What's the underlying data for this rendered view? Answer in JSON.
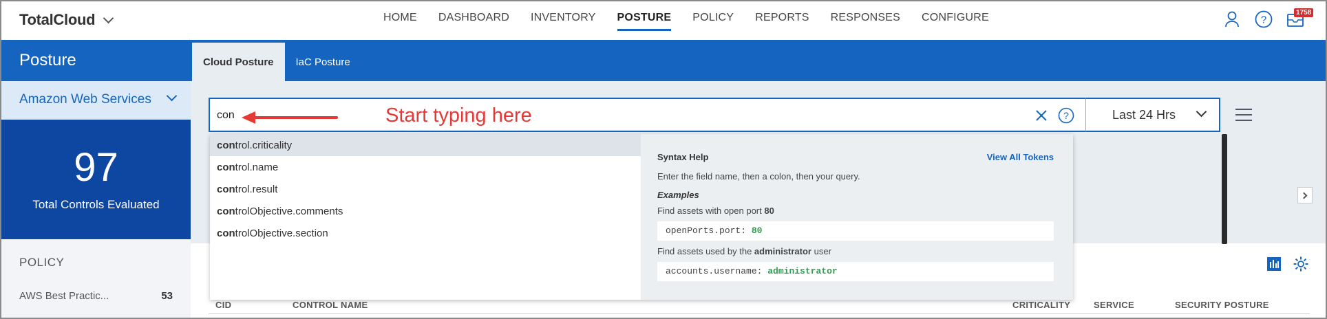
{
  "app": {
    "name": "TotalCloud"
  },
  "nav": {
    "items": [
      "HOME",
      "DASHBOARD",
      "INVENTORY",
      "POSTURE",
      "POLICY",
      "REPORTS",
      "RESPONSES",
      "CONFIGURE"
    ],
    "active": "POSTURE",
    "notification_count": "1758",
    "icons": [
      "user-icon",
      "help-icon",
      "notification-icon"
    ]
  },
  "sidebar": {
    "title": "Posture",
    "provider": "Amazon Web Services",
    "stat_value": "97",
    "stat_label": "Total Controls Evaluated",
    "policy_heading": "POLICY",
    "policy_items": [
      {
        "name": "AWS Best Practic...",
        "count": "53"
      }
    ]
  },
  "tabs": [
    {
      "label": "Cloud Posture",
      "active": true
    },
    {
      "label": "IaC Posture",
      "active": false
    }
  ],
  "search": {
    "value": "con",
    "annotation": "Start typing here",
    "time_range": "Last 24 Hrs"
  },
  "suggestions": [
    {
      "match": "con",
      "rest": "trol.criticality",
      "highlighted": true
    },
    {
      "match": "con",
      "rest": "trol.name",
      "highlighted": false
    },
    {
      "match": "con",
      "rest": "trol.result",
      "highlighted": false
    },
    {
      "match": "con",
      "rest": "trolObjective.comments",
      "highlighted": false
    },
    {
      "match": "con",
      "rest": "trolObjective.section",
      "highlighted": false
    }
  ],
  "syntax_help": {
    "title": "Syntax Help",
    "link": "View All Tokens",
    "description": "Enter the field name, then a colon, then your query.",
    "examples_label": "Examples",
    "example1_text": "Find assets with open port ",
    "example1_bold": "80",
    "example1_code_key": "openPorts.port:",
    "example1_code_val": "80",
    "example2_text_a": "Find assets used by the ",
    "example2_bold": "administrator",
    "example2_text_b": " user",
    "example2_code_key": "accounts.username:",
    "example2_code_val": "administrator"
  },
  "table": {
    "columns": [
      "CID",
      "CONTROL NAME",
      "CRITICALITY",
      "SERVICE",
      "SECURITY POSTURE"
    ]
  },
  "colors": {
    "primary": "#1565c0",
    "dark": "#0d47a1",
    "annotation": "#e53935",
    "code_value": "#2e9e4f"
  }
}
